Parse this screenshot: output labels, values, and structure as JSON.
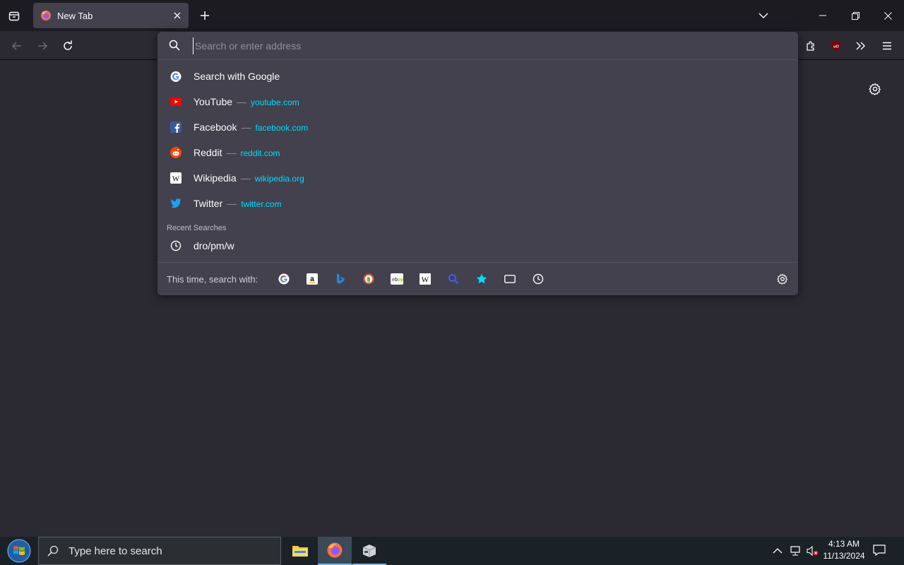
{
  "browser": {
    "tab": {
      "title": "New Tab"
    },
    "urlbar": {
      "placeholder": "Search or enter address",
      "results": [
        {
          "label": "Search with Google",
          "url": "",
          "icon": "google-icon"
        },
        {
          "label": "YouTube",
          "url": "youtube.com",
          "icon": "youtube-icon"
        },
        {
          "label": "Facebook",
          "url": "facebook.com",
          "icon": "facebook-icon"
        },
        {
          "label": "Reddit",
          "url": "reddit.com",
          "icon": "reddit-icon"
        },
        {
          "label": "Wikipedia",
          "url": "wikipedia.org",
          "icon": "wikipedia-icon"
        },
        {
          "label": "Twitter",
          "url": "twitter.com",
          "icon": "twitter-icon"
        }
      ],
      "separator": "—",
      "recent_title": "Recent Searches",
      "recent": [
        {
          "label": "dro/pm/w",
          "icon": "history-icon"
        }
      ],
      "oneoff_label": "This time, search with:",
      "engines": [
        "google",
        "amazon",
        "bing",
        "duckduckgo",
        "ebay",
        "wikipedia",
        "search",
        "bookmarks",
        "tabs",
        "history"
      ]
    }
  },
  "taskbar": {
    "search_placeholder": "Type here to search",
    "time": "4:13 AM",
    "date": "11/13/2024"
  },
  "colors": {
    "accent_url": "#00ddff",
    "panel": "#42414d",
    "background": "#2b2a33"
  }
}
